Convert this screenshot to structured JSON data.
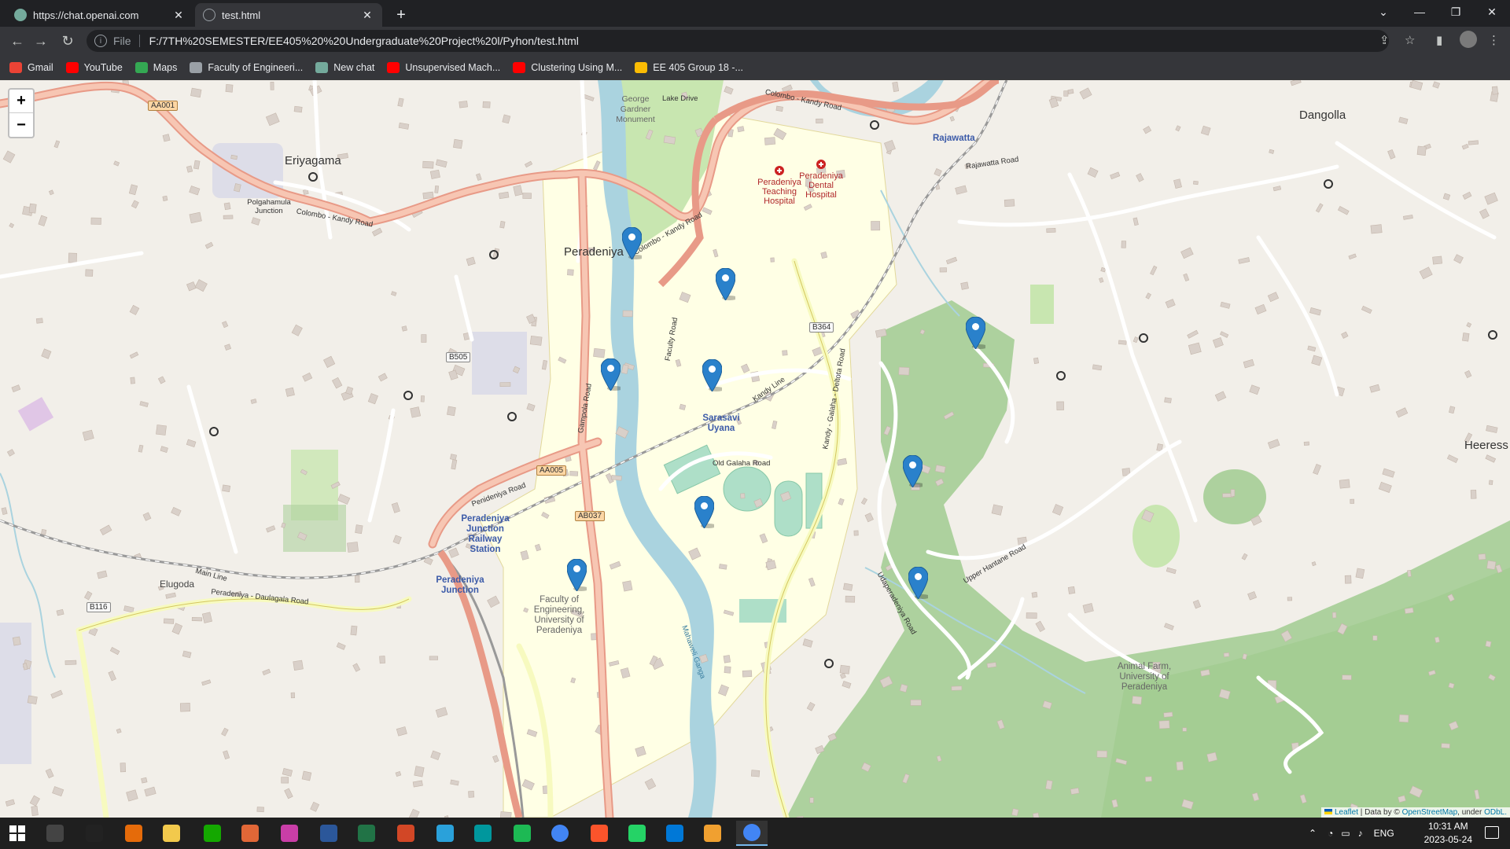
{
  "browser": {
    "tabs": [
      {
        "title": "https://chat.openai.com",
        "active": false,
        "favicon": "openai-icon"
      },
      {
        "title": "test.html",
        "active": true,
        "favicon": "globe-icon"
      }
    ],
    "new_tab_symbol": "+",
    "address": {
      "scheme": "File",
      "url": "F:/7TH%20SEMESTER/EE405%20%20Undergraduate%20Project%20l/Pyhon/test.html"
    },
    "bookmarks": [
      {
        "label": "Gmail",
        "icon": "gmail-icon",
        "color": "#ea4335"
      },
      {
        "label": "YouTube",
        "icon": "youtube-icon",
        "color": "#ff0000"
      },
      {
        "label": "Maps",
        "icon": "maps-icon",
        "color": "#34a853"
      },
      {
        "label": "Faculty of Engineeri...",
        "icon": "faculty-icon",
        "color": "#9aa0a6"
      },
      {
        "label": "New chat",
        "icon": "openai-icon",
        "color": "#74aa9c"
      },
      {
        "label": "Unsupervised Mach...",
        "icon": "youtube-icon",
        "color": "#ff0000"
      },
      {
        "label": "Clustering Using M...",
        "icon": "youtube-icon",
        "color": "#ff0000"
      },
      {
        "label": "EE 405 Group 18 -...",
        "icon": "drive-icon",
        "color": "#fbbc04"
      }
    ]
  },
  "map": {
    "zoom_in": "+",
    "zoom_out": "−",
    "attribution": {
      "leaflet": "Leaflet",
      "data_by": "| Data by ©",
      "osm": "OpenStreetMap",
      "under": ", under",
      "odbl": "ODbL."
    },
    "places": {
      "eriyagama": "Eriyagama",
      "peradeniya": "Peradeniya",
      "dangolla": "Dangolla",
      "heeress": "Heeress",
      "elugoda": "Elugoda",
      "rajawatta": "Rajawatta",
      "sarasavi_uyana": "Sarasavi Uyana",
      "station": "Peradeniya Junction Railway Station",
      "junction": "Peradeniya Junction",
      "faculty": "Faculty of Engineering, University of Peradeniya",
      "teaching_hospital": "Peradeniya Teaching Hospital",
      "dental_hospital": "Peradeniya Dental Hospital",
      "animal_farm": "Animal Farm, University of Peradeniya",
      "george_monument": "George Gardner Monument",
      "polgahamula": "Polgahamula Junction"
    },
    "roads": {
      "colombo_kandy_1": "Colombo - Kandy Road",
      "colombo_kandy_2": "Colombo - Kandy Road",
      "colombo_kandy_3": "Colombo - Kandy Road",
      "old_galaha": "Old Galaha Road",
      "gampola": "Gampola Road",
      "peradeniya_daulagala": "Peradeniya - Daulagala Road",
      "upper_hantane": "Upper Hantane Road",
      "kandy_galaha": "Kandy - Galaha - Deltota Road",
      "penideniya": "Penideniya Road",
      "faculty_road": "Faculty Road",
      "lake_drive": "Lake Drive",
      "kandy_line": "Kandy Line",
      "main_line": "Main Line",
      "mahaweli": "Mahaweli Ganga",
      "rajawatta_road": "Rajawatta Road",
      "udaperadeniya": "Udaperadeniya Road"
    },
    "shields": [
      "AA001",
      "B505",
      "AA005",
      "AB037",
      "B364",
      "B116"
    ],
    "marker_color": "#2a81cb",
    "marker_count": 10
  },
  "taskbar": {
    "apps": [
      {
        "name": "start",
        "icon": "windows-icon"
      },
      {
        "name": "task-view",
        "icon": "task-view-icon"
      },
      {
        "name": "terminal",
        "icon": "terminal-icon"
      },
      {
        "name": "media-player",
        "icon": "media-icon"
      },
      {
        "name": "file-explorer",
        "icon": "folder-icon"
      },
      {
        "name": "upwork",
        "icon": "upwork-icon"
      },
      {
        "name": "matlab",
        "icon": "matlab-icon"
      },
      {
        "name": "snipping",
        "icon": "snip-icon"
      },
      {
        "name": "word",
        "icon": "word-icon"
      },
      {
        "name": "excel",
        "icon": "excel-icon"
      },
      {
        "name": "powerpoint",
        "icon": "powerpoint-icon"
      },
      {
        "name": "telegram",
        "icon": "telegram-icon"
      },
      {
        "name": "arduino",
        "icon": "arduino-icon"
      },
      {
        "name": "spotify",
        "icon": "spotify-icon"
      },
      {
        "name": "chrome",
        "icon": "chrome-icon"
      },
      {
        "name": "brave",
        "icon": "brave-icon"
      },
      {
        "name": "whatsapp",
        "icon": "whatsapp-icon"
      },
      {
        "name": "vscode",
        "icon": "vscode-icon"
      },
      {
        "name": "inkscape",
        "icon": "inkscape-icon"
      },
      {
        "name": "chrome-active",
        "icon": "chrome-icon"
      }
    ],
    "language": "ENG",
    "time": "10:31 AM",
    "date": "2023-05-24"
  }
}
